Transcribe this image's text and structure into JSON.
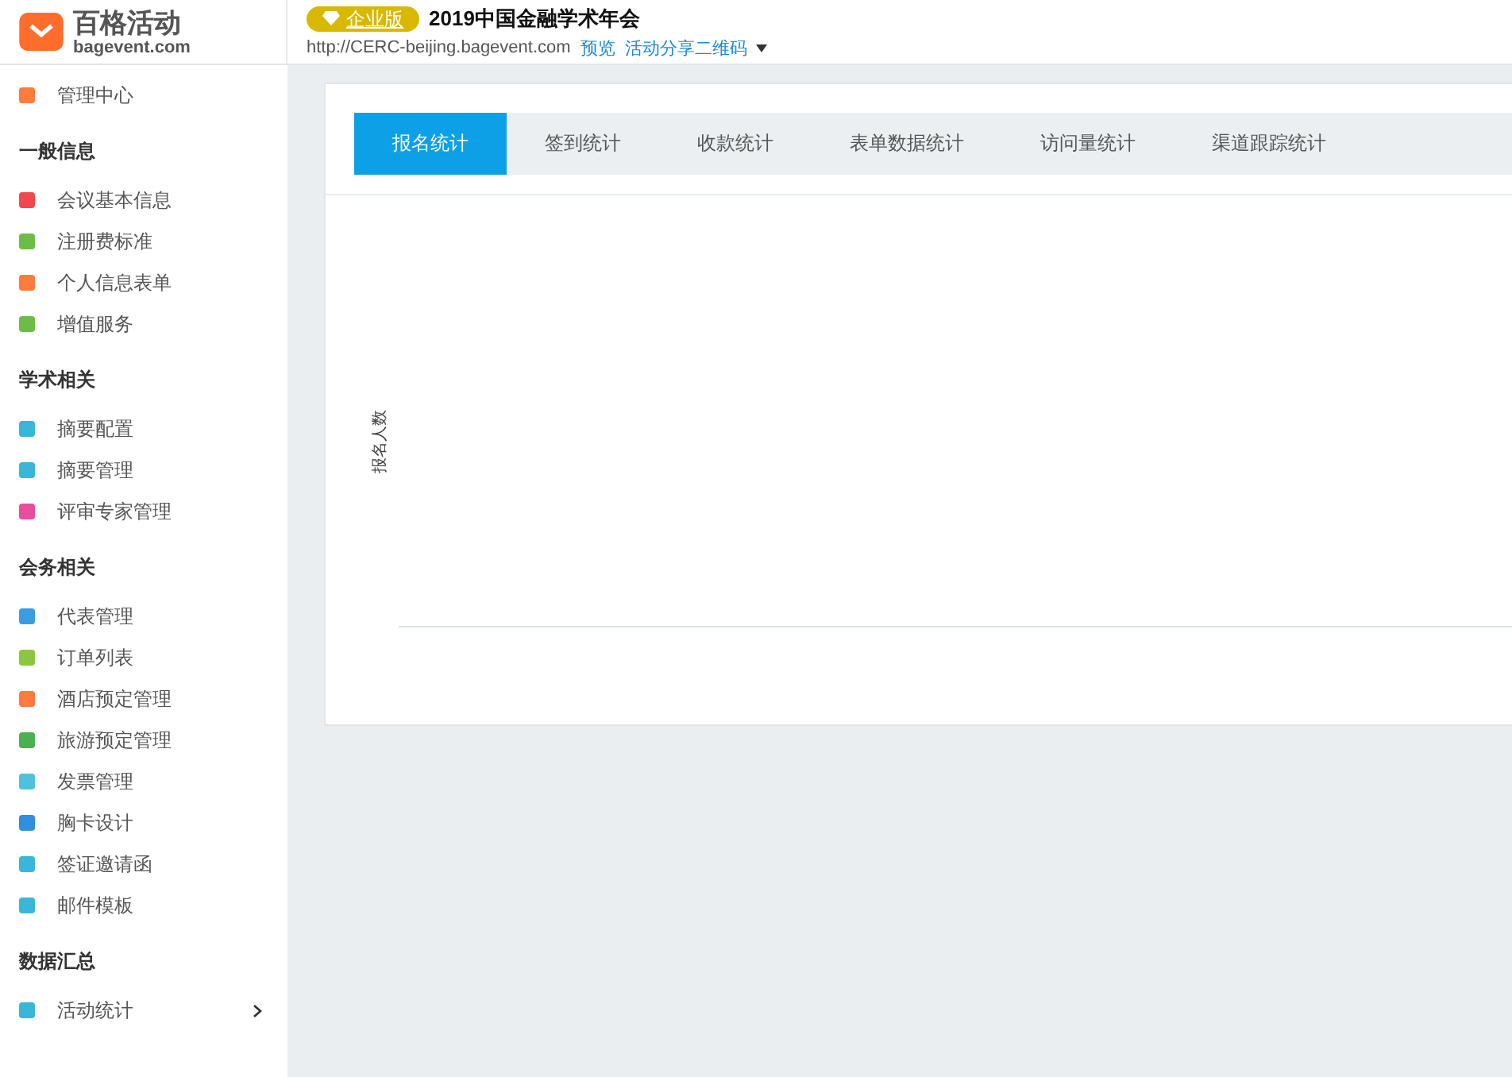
{
  "header": {
    "logo_text": "百格活动",
    "logo_domain": "bagevent.com",
    "edition_badge": "企业版",
    "event_title": "2019中国金融学术年会",
    "event_url": "http://CERC-beijing.bagevent.com",
    "links": [
      "预览",
      "活动分享二维码"
    ]
  },
  "sidebar": {
    "groups": [
      {
        "items": [
          {
            "label": "管理中心",
            "color": "#ff7a3d",
            "has_submenu": false
          }
        ]
      },
      {
        "title": "一般信息",
        "items": [
          {
            "label": "会议基本信息",
            "color": "#f2474f",
            "has_submenu": false
          },
          {
            "label": "注册费标准",
            "color": "#6cbd45",
            "has_submenu": false
          },
          {
            "label": "个人信息表单",
            "color": "#ff7a3d",
            "has_submenu": false
          },
          {
            "label": "增值服务",
            "color": "#6cbd45",
            "has_submenu": false
          }
        ]
      },
      {
        "title": "学术相关",
        "items": [
          {
            "label": "摘要配置",
            "color": "#39b6d8",
            "has_submenu": false
          },
          {
            "label": "摘要管理",
            "color": "#39b6d8",
            "has_submenu": false
          },
          {
            "label": "评审专家管理",
            "color": "#e84d9c",
            "has_submenu": false
          }
        ]
      },
      {
        "title": "会务相关",
        "items": [
          {
            "label": "代表管理",
            "color": "#3a9de0",
            "has_submenu": false
          },
          {
            "label": "订单列表",
            "color": "#8cc63f",
            "has_submenu": false
          },
          {
            "label": "酒店预定管理",
            "color": "#ff7a3d",
            "has_submenu": false
          },
          {
            "label": "旅游预定管理",
            "color": "#4caf50",
            "has_submenu": false
          },
          {
            "label": "发票管理",
            "color": "#4fc1e0",
            "has_submenu": false
          },
          {
            "label": "胸卡设计",
            "color": "#2f8fe0",
            "has_submenu": false
          },
          {
            "label": "签证邀请函",
            "color": "#39b6d8",
            "has_submenu": false
          },
          {
            "label": "邮件模板",
            "color": "#39b6d8",
            "has_submenu": false
          }
        ]
      },
      {
        "title": "数据汇总",
        "items": [
          {
            "label": "活动统计",
            "color": "#39b6d8",
            "has_submenu": true
          }
        ]
      }
    ]
  },
  "stats": {
    "tabs": [
      {
        "label": "报名统计",
        "selected": true
      },
      {
        "label": "签到统计",
        "selected": false
      },
      {
        "label": "收款统计",
        "selected": false
      },
      {
        "label": "表单数据统计",
        "selected": false
      },
      {
        "label": "访问量统计",
        "selected": false
      },
      {
        "label": "渠道跟踪统计",
        "selected": false
      }
    ],
    "chart": {
      "ylabel": "报名人数"
    }
  }
}
